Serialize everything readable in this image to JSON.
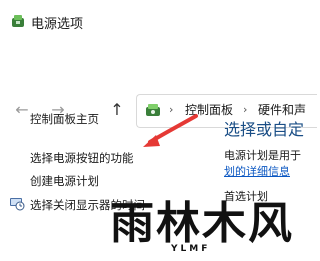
{
  "window": {
    "title": "电源选项"
  },
  "nav": {
    "back_glyph": "←",
    "forward_glyph": "→",
    "up_glyph": "↑"
  },
  "address": {
    "separator1": "›",
    "segment1": "控制面板",
    "separator2": "›",
    "segment2": "硬件和声"
  },
  "sidebar": {
    "items": [
      {
        "label": "控制面板主页"
      },
      {
        "label": "选择电源按钮的功能"
      },
      {
        "label": "创建电源计划"
      },
      {
        "label": "选择关闭显示器的时间"
      }
    ]
  },
  "main": {
    "heading": "选择或自定",
    "description": "电源计划是用于",
    "link": "划的详细信息",
    "subheading": "首选计划"
  },
  "watermark": {
    "text": "雨林木风",
    "sub": "YLMF"
  },
  "colors": {
    "arrow": "#e53935",
    "heading": "#1a4e86",
    "link": "#0b57c2"
  },
  "icons": {
    "app": "power-options-icon",
    "address": "control-panel-icon",
    "sidebar": "display-clock-icon"
  }
}
